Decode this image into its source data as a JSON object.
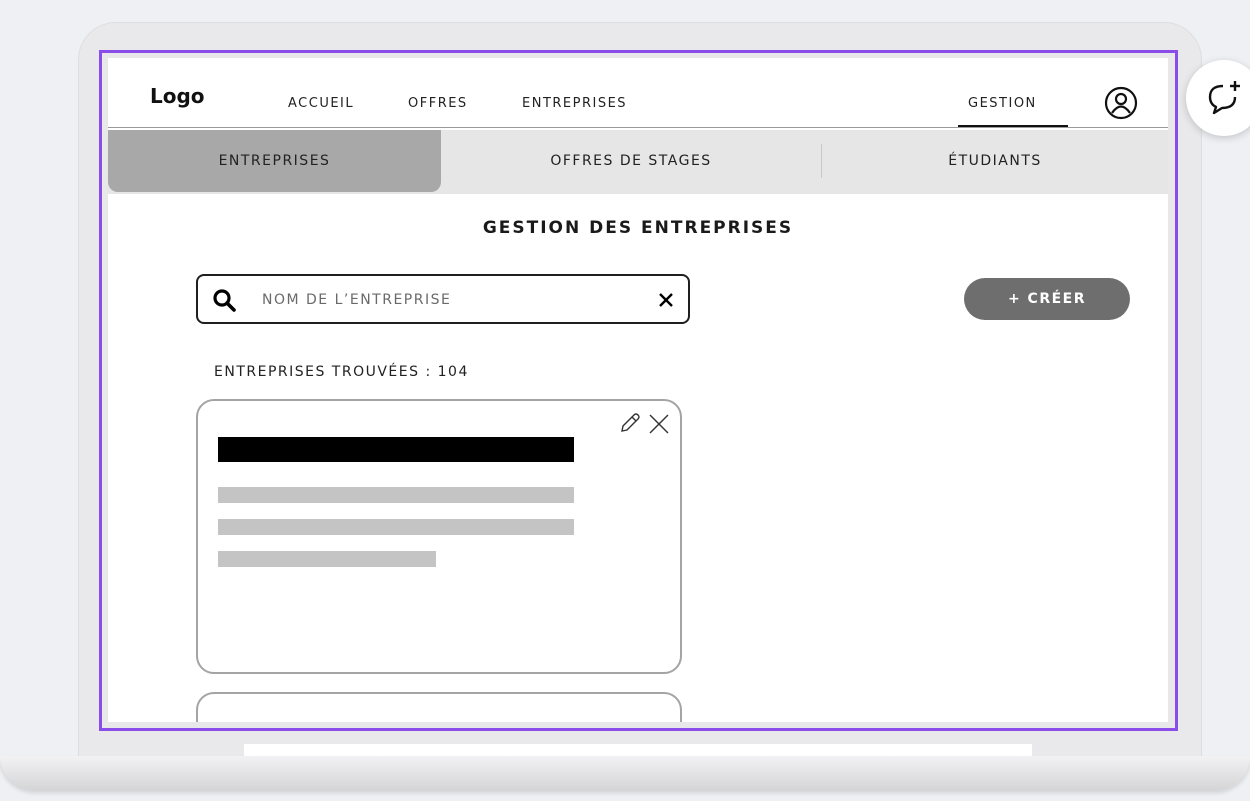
{
  "nav": {
    "logo": "Logo",
    "links": [
      "ACCUEIL",
      "OFFRES",
      "ENTREPRISES"
    ],
    "gestion": "GESTION"
  },
  "subtabs": [
    "ENTREPRISES",
    "OFFRES DE STAGES",
    "ÉTUDIANTS"
  ],
  "main": {
    "title": "GESTION DES ENTREPRISES",
    "search": {
      "placeholder": "NOM DE L’ENTREPRISE",
      "value": ""
    },
    "create_label": "+ CRÉER",
    "found_count": "ENTREPRISES TROUVÉES : 104"
  },
  "icons": {
    "user": "user-circle-icon",
    "search": "search-icon",
    "clear": "close-icon",
    "edit": "pencil-icon",
    "delete": "close-icon",
    "chat": "chat-add-icon"
  },
  "colors": {
    "frame_highlight": "#8b4dea",
    "active_tab": "#a8a8a8",
    "tab_bar": "#e6e6e6",
    "create_button": "#6e6e6e"
  }
}
